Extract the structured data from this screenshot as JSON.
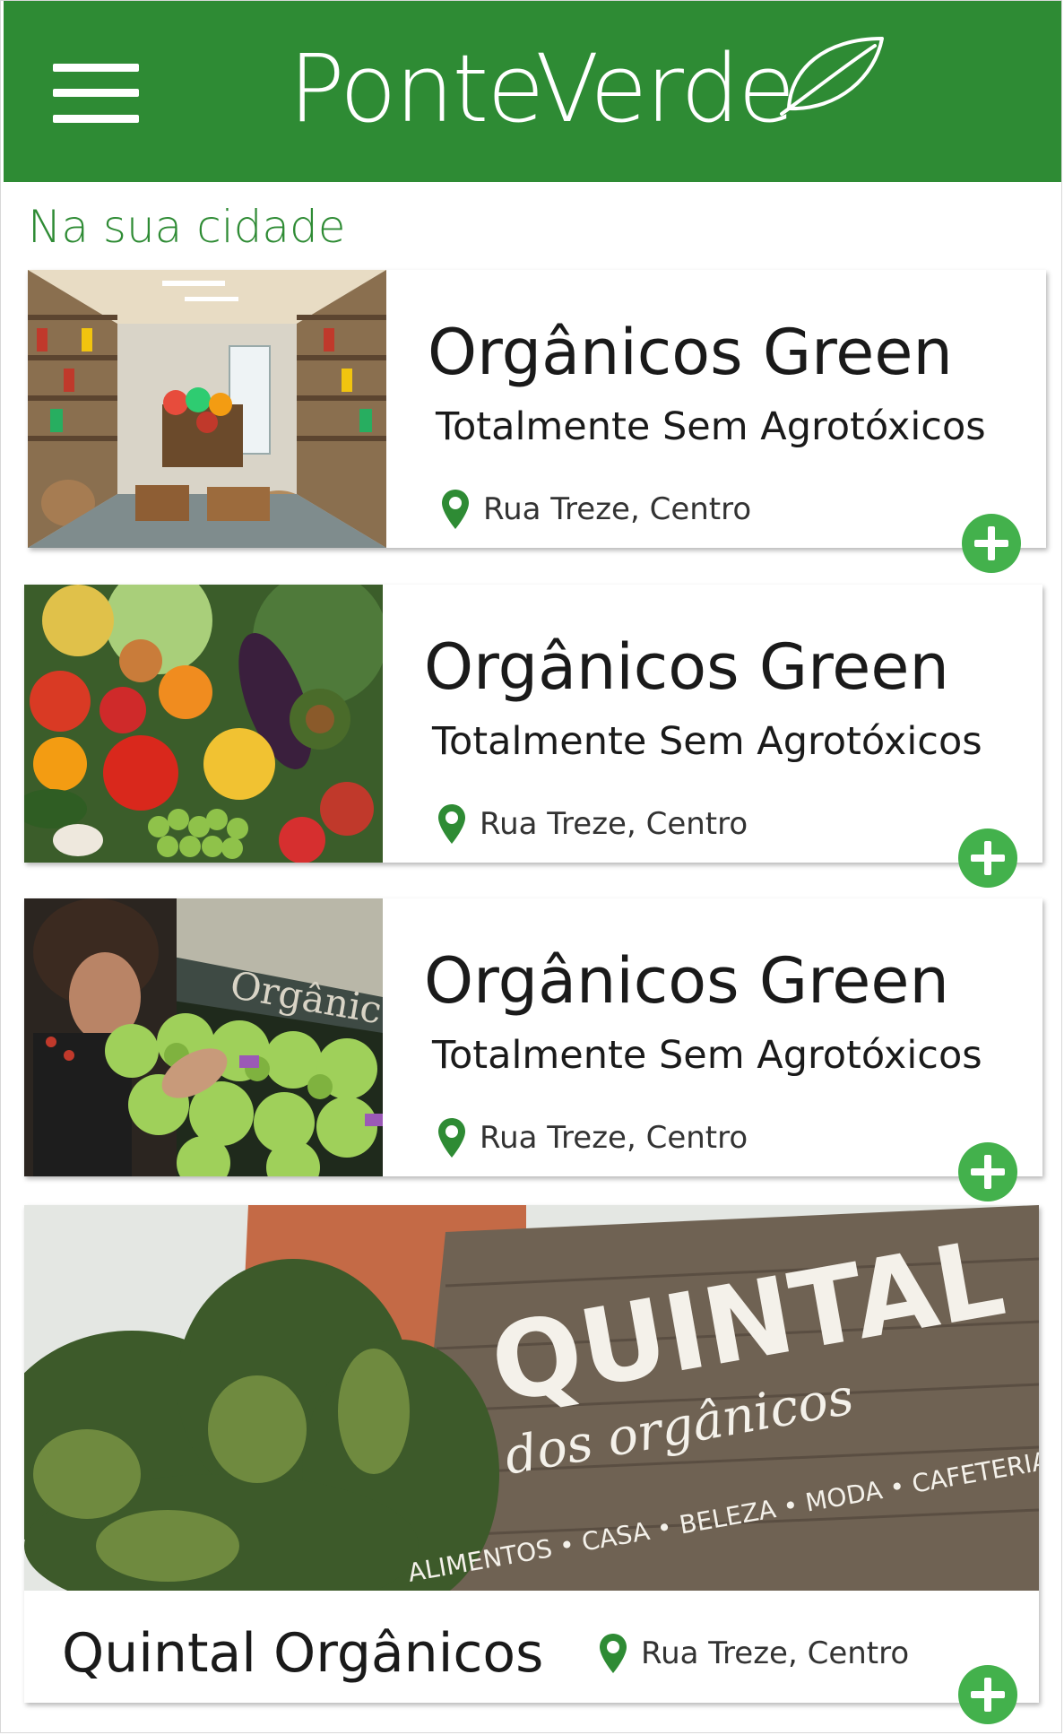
{
  "header": {
    "brand": "PonteVerde",
    "brand_color": "#2e8b34"
  },
  "section": {
    "title": "Na sua cidade"
  },
  "stores": [
    {
      "name": "Orgânicos Green",
      "tagline": "Totalmente Sem Agrotóxicos",
      "address": "Rua Treze, Centro",
      "image": "store-interior-photo"
    },
    {
      "name": "Orgânicos Green",
      "tagline": "Totalmente Sem Agrotóxicos",
      "address": "Rua Treze, Centro",
      "image": "vegetables-photo"
    },
    {
      "name": "Orgânicos Green",
      "tagline": "Totalmente Sem Agrotóxicos",
      "address": "Rua Treze, Centro",
      "image": "produce-shelf-photo"
    }
  ],
  "featured": {
    "name": "Quintal Orgânicos",
    "address": "Rua Treze, Centro",
    "image": "quintal-storefront-photo",
    "sign": {
      "main": "QUINTAL",
      "sub": "dos orgânicos",
      "categories": "ALIMENTOS • CASA • BELEZA • MODA • CAFETERIA"
    }
  },
  "icons": {
    "menu": "hamburger-menu-icon",
    "logo": "leaf-icon",
    "location": "map-pin-icon",
    "add": "plus-circle-icon"
  },
  "colors": {
    "accent": "#43b14c",
    "pin": "#2e8b34"
  }
}
